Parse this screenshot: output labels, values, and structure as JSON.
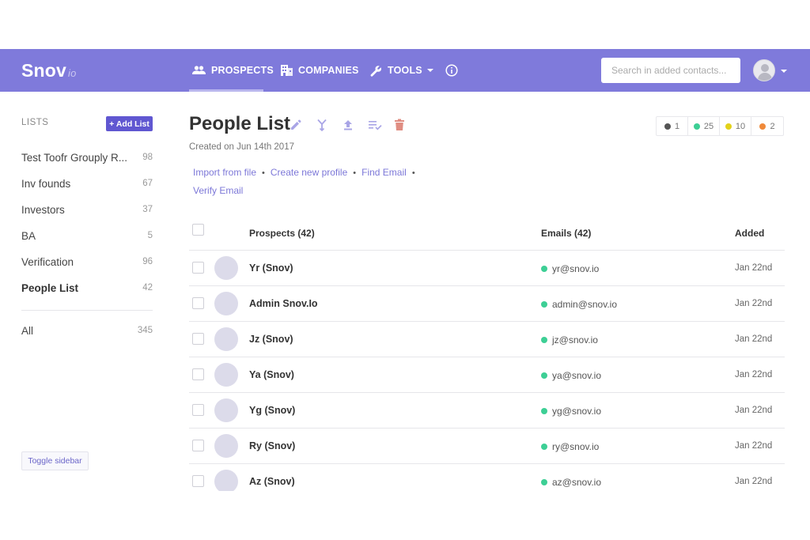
{
  "app": {
    "logo": "Snov",
    "logo_suffix": "io"
  },
  "nav": {
    "prospects": "PROSPECTS",
    "companies": "COMPANIES",
    "tools": "TOOLS",
    "active": "PROSPECTS"
  },
  "search": {
    "placeholder": "Search in added contacts..."
  },
  "sidebar": {
    "title": "LISTS",
    "add_label": "+ Add List",
    "items": [
      {
        "label": "Test Toofr Grouply R...",
        "count": "98"
      },
      {
        "label": "Inv founds",
        "count": "67"
      },
      {
        "label": "Investors",
        "count": "37"
      },
      {
        "label": "BA",
        "count": "5"
      },
      {
        "label": "Verification",
        "count": "96"
      },
      {
        "label": "People List",
        "count": "42",
        "active": true
      }
    ],
    "all": {
      "label": "All",
      "count": "345"
    },
    "toggle_label": "Toggle sidebar"
  },
  "main": {
    "title": "People List",
    "created": "Created on Jun 14th 2017",
    "links": {
      "import": "Import from file",
      "create": "Create new profile",
      "find": "Find Email",
      "verify": "Verify Email"
    },
    "badges": [
      {
        "count": "1",
        "color": "#555555"
      },
      {
        "count": "25",
        "color": "#3dcf95"
      },
      {
        "count": "10",
        "color": "#e3d21a"
      },
      {
        "count": "2",
        "color": "#f08a3a"
      }
    ]
  },
  "table": {
    "headers": {
      "prospects": "Prospects (42)",
      "emails": "Emails (42)",
      "added": "Added"
    },
    "rows": [
      {
        "name": "Yr (Snov)",
        "email": "yr@snov.io",
        "added": "Jan 22nd"
      },
      {
        "name": "Admin Snov.Io",
        "email": "admin@snov.io",
        "added": "Jan 22nd"
      },
      {
        "name": "Jz (Snov)",
        "email": "jz@snov.io",
        "added": "Jan 22nd"
      },
      {
        "name": "Ya (Snov)",
        "email": "ya@snov.io",
        "added": "Jan 22nd"
      },
      {
        "name": "Yg (Snov)",
        "email": "yg@snov.io",
        "added": "Jan 22nd"
      },
      {
        "name": "Ry (Snov)",
        "email": "ry@snov.io",
        "added": "Jan 22nd"
      },
      {
        "name": "Az (Snov)",
        "email": "az@snov.io",
        "added": "Jan 22nd"
      }
    ]
  },
  "colors": {
    "header_bg": "#7f7adb",
    "accent": "#6057d1",
    "link": "#7d78d8",
    "email_valid": "#3dcf95"
  }
}
